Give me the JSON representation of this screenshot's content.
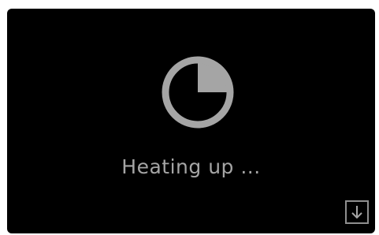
{
  "status": {
    "text": "Heating up ...",
    "progress_fraction": 0.25,
    "color": "#a5a5a5"
  },
  "icons": {
    "progress": "pie-progress-icon",
    "download": "arrow-down-icon"
  },
  "theme": {
    "background": "#000000",
    "accent": "#a5a5a5",
    "button_border": "#8f8f8f"
  }
}
